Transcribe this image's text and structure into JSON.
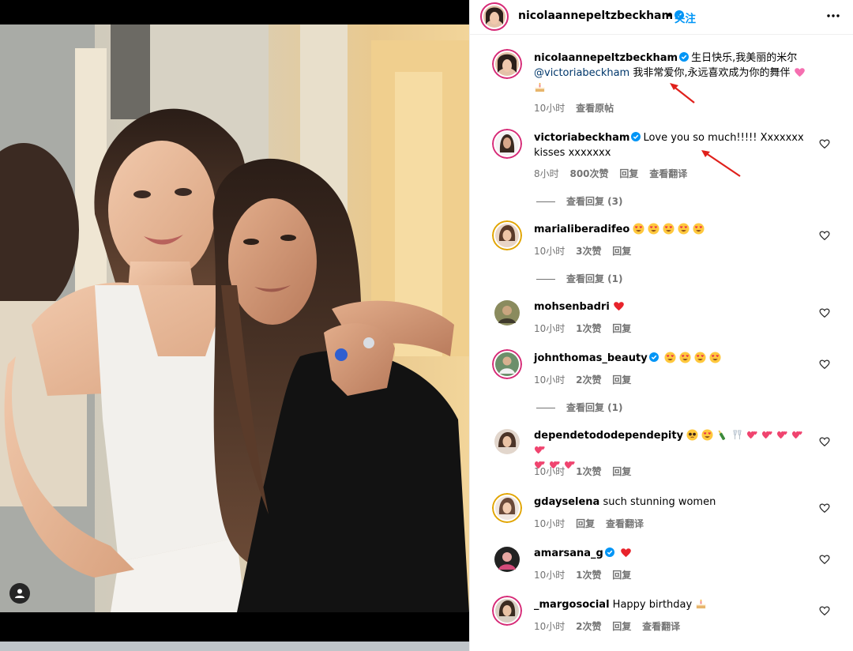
{
  "post": {
    "author": "nicolaannepeltzbeckham",
    "dot": "•",
    "follow_label": "关注",
    "more_icon": "more-horizontal-icon"
  },
  "caption": {
    "username": "nicolaannepeltzbeckham",
    "text_before": "生日快乐,我美丽的米尔",
    "mention": "@victoriabeckham",
    "text_after": "我非常爱你,永远喜欢成为你的舞伴",
    "emojis": [
      "pink-heart",
      "birthday-cake"
    ],
    "time": "10小时",
    "translate": "查看原帖"
  },
  "comments": [
    {
      "username": "victoriabeckham",
      "verified": true,
      "text": "Love you so much!!!!! Xxxxxxx kisses xxxxxxx",
      "time": "8小时",
      "likes": "800次赞",
      "reply": "回复",
      "translate": "查看翻译",
      "replies": "查看回复 (3)"
    },
    {
      "username": "marialiberadifeo",
      "verified": false,
      "emojis": [
        "heart-eyes",
        "heart-eyes",
        "heart-eyes",
        "heart-eyes",
        "heart-eyes"
      ],
      "time": "10小时",
      "likes": "3次赞",
      "reply": "回复",
      "replies": "查看回复 (1)"
    },
    {
      "username": "mohsenbadri",
      "verified": false,
      "emojis": [
        "red-heart"
      ],
      "time": "10小时",
      "likes": "1次赞",
      "reply": "回复"
    },
    {
      "username": "johnthomas_beauty",
      "verified": true,
      "emojis": [
        "heart-eyes",
        "heart-eyes",
        "heart-eyes",
        "heart-eyes"
      ],
      "time": "10小时",
      "likes": "2次赞",
      "reply": "回复",
      "replies": "查看回复 (1)"
    },
    {
      "username": "dependetododependepity",
      "verified": false,
      "emojis": [
        "pleading",
        "heart-eyes",
        "champagne",
        "clinking-glasses",
        "two-hearts",
        "two-hearts",
        "two-hearts",
        "two-hearts",
        "two-hearts",
        "two-hearts",
        "two-hearts",
        "two-hearts"
      ],
      "time": "10小时",
      "likes": "1次赞",
      "reply": "回复"
    },
    {
      "username": "gdayselena",
      "verified": false,
      "text": "such stunning women",
      "time": "10小时",
      "reply": "回复",
      "translate": "查看翻译"
    },
    {
      "username": "amarsana_g",
      "verified": true,
      "emojis": [
        "red-heart"
      ],
      "time": "10小时",
      "likes": "1次赞",
      "reply": "回复"
    },
    {
      "username": "_margosocial",
      "verified": false,
      "text": "Happy birthday",
      "emojis": [
        "birthday-cake"
      ],
      "time": "10小时",
      "likes": "2次赞",
      "reply": "回复",
      "translate": "查看翻译"
    }
  ],
  "colors": {
    "link_blue": "#0095f6",
    "mention_blue": "#00376b",
    "verified_blue": "#0095f6",
    "meta_gray": "#737373",
    "annotation_red": "#e0201b",
    "story_ring": "#d62976"
  }
}
